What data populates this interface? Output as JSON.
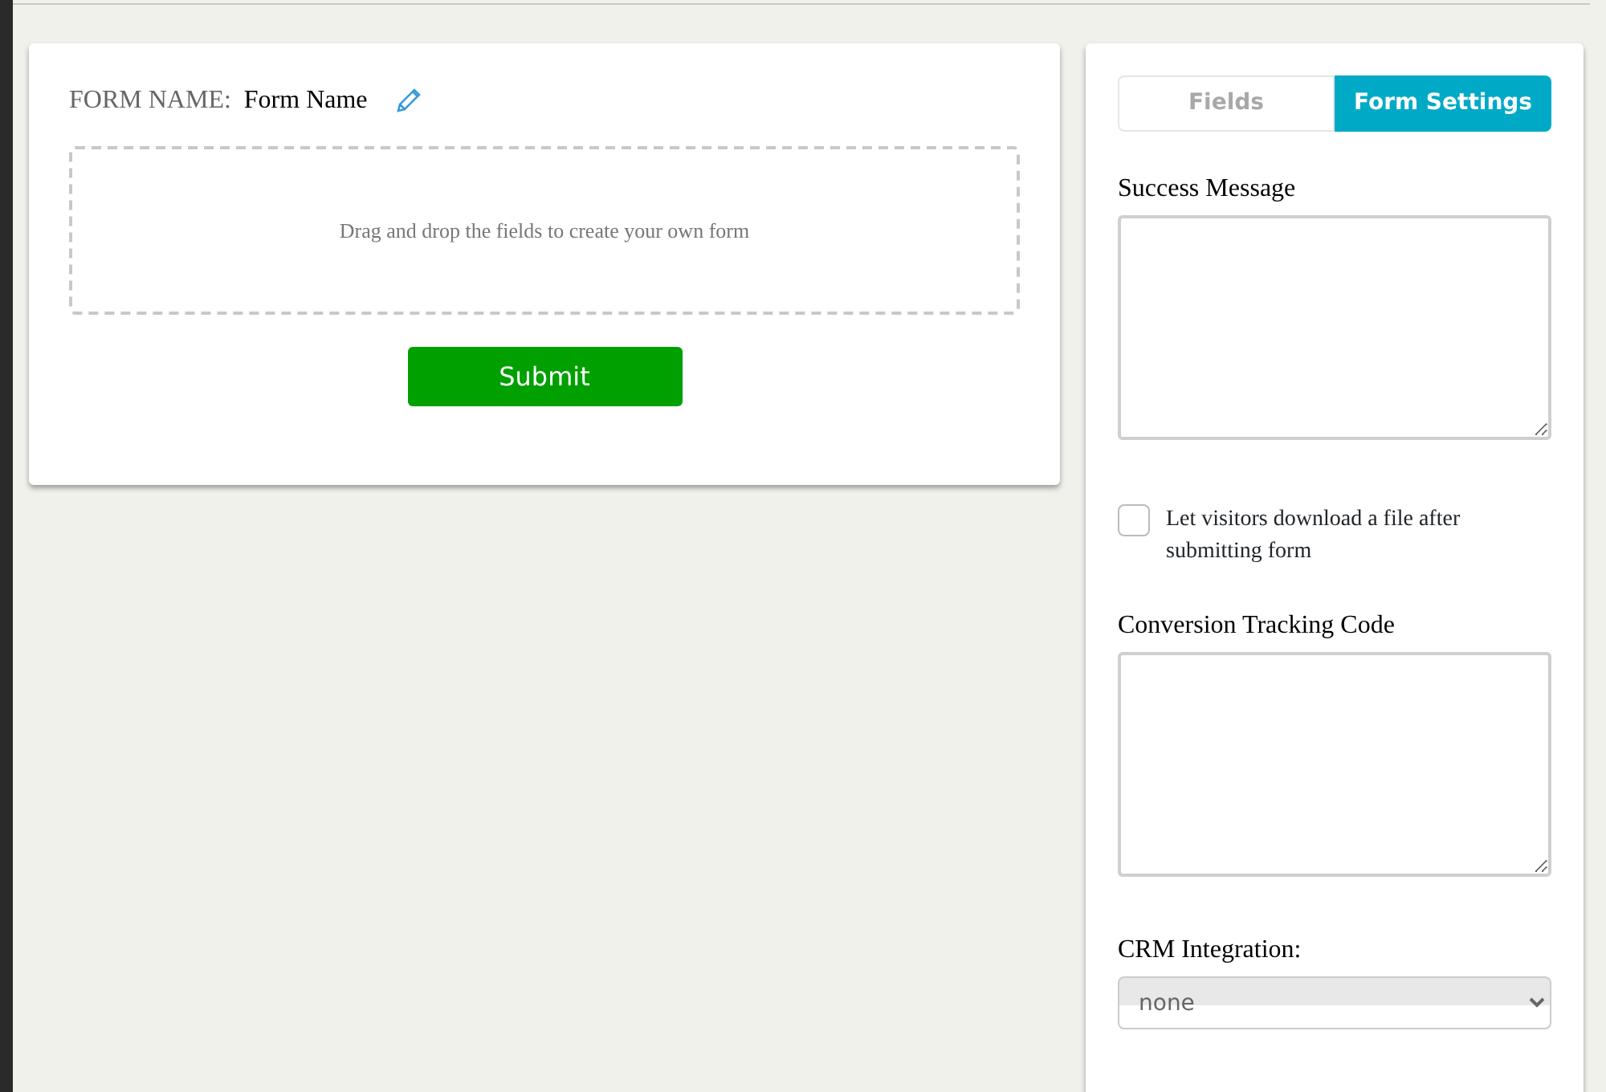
{
  "form_builder": {
    "name_label": "FORM NAME:",
    "name_value": "Form Name",
    "dropzone_text": "Drag and drop the fields to create your own form",
    "submit_button": "Submit"
  },
  "settings_panel": {
    "tabs": [
      {
        "label": "Fields",
        "selected": false
      },
      {
        "label": "Form Settings",
        "selected": true
      }
    ],
    "success_message": {
      "label": "Success Message"
    },
    "download_option": {
      "label": "Let visitors download a file after submitting form",
      "checked": false
    },
    "conversion_tracking": {
      "label": "Conversion Tracking Code"
    },
    "crm_integration": {
      "label": "CRM Integration:",
      "value": "none"
    }
  }
}
